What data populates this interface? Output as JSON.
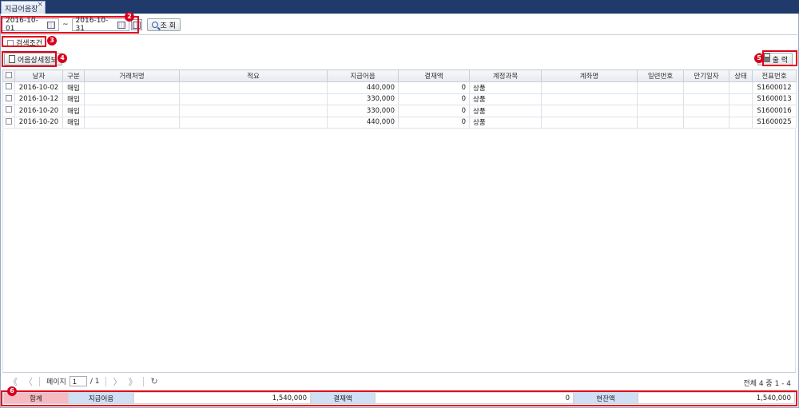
{
  "tab": {
    "title": "지급어음장",
    "close": "×"
  },
  "filter": {
    "date_from": "2016-10-01",
    "separator": "~",
    "date_to": "2016-10-31",
    "search_label": "조 회",
    "search_condition_label": "검색조건"
  },
  "actions": {
    "detail_label": "어음상세정보",
    "print_label": "출 력"
  },
  "markers": [
    "2",
    "3",
    "4",
    "5",
    "6"
  ],
  "table": {
    "headers": [
      "날자",
      "구분",
      "거래처명",
      "적요",
      "지급어음",
      "결재액",
      "계정과목",
      "계좌명",
      "일련번호",
      "만기일자",
      "상태",
      "전표번호"
    ],
    "rows": [
      [
        "2016-10-02",
        "매입",
        "",
        "",
        "440,000",
        "0",
        "상품",
        "",
        "",
        "",
        "",
        "S1600012"
      ],
      [
        "2016-10-12",
        "매입",
        "",
        "",
        "330,000",
        "0",
        "상품",
        "",
        "",
        "",
        "",
        "S1600013"
      ],
      [
        "2016-10-20",
        "매입",
        "",
        "",
        "330,000",
        "0",
        "상품",
        "",
        "",
        "",
        "",
        "S1600016"
      ],
      [
        "2016-10-20",
        "매입",
        "",
        "",
        "440,000",
        "0",
        "상품",
        "",
        "",
        "",
        "",
        "S1600025"
      ]
    ]
  },
  "pager": {
    "first": "《",
    "prev": "〈",
    "page_label": "페이지",
    "page": "1",
    "total_pages": "/ 1",
    "next": "〉",
    "last": "》",
    "refresh": "↻",
    "info": "전체 4 중 1 - 4"
  },
  "totals": {
    "sum_label": "합계",
    "bill_label": "지급어음",
    "bill_value": "1,540,000",
    "paid_label": "결재액",
    "paid_value": "0",
    "balance_label": "현잔액",
    "balance_value": "1,540,000"
  },
  "colors": {
    "tabbar": "#1f3a6b",
    "highlight": "#e0001a",
    "sum_bg": "#f7b9c2",
    "label_bg": "#cfe0f5"
  }
}
